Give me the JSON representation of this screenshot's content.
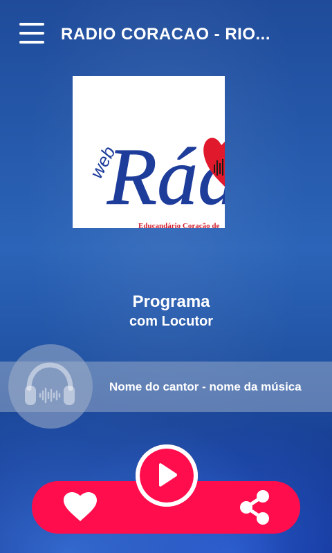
{
  "app": {
    "title": "RADIO CORACAO - RIO..."
  },
  "colors": {
    "accent": "#ff0d4d",
    "background": "#2b64b8"
  },
  "cover": {
    "logo_text_small": "web",
    "logo_text_large": "Rádi",
    "logo_caption": "Educandário Coração de"
  },
  "program": {
    "title": "Programa",
    "subtitle": "com Locutor"
  },
  "now_playing": {
    "song": "Nome do cantor - nome da música",
    "icon": "headphones-icon"
  },
  "controls": {
    "favorite_icon": "heart-icon",
    "play_icon": "play-icon",
    "share_icon": "share-icon"
  }
}
